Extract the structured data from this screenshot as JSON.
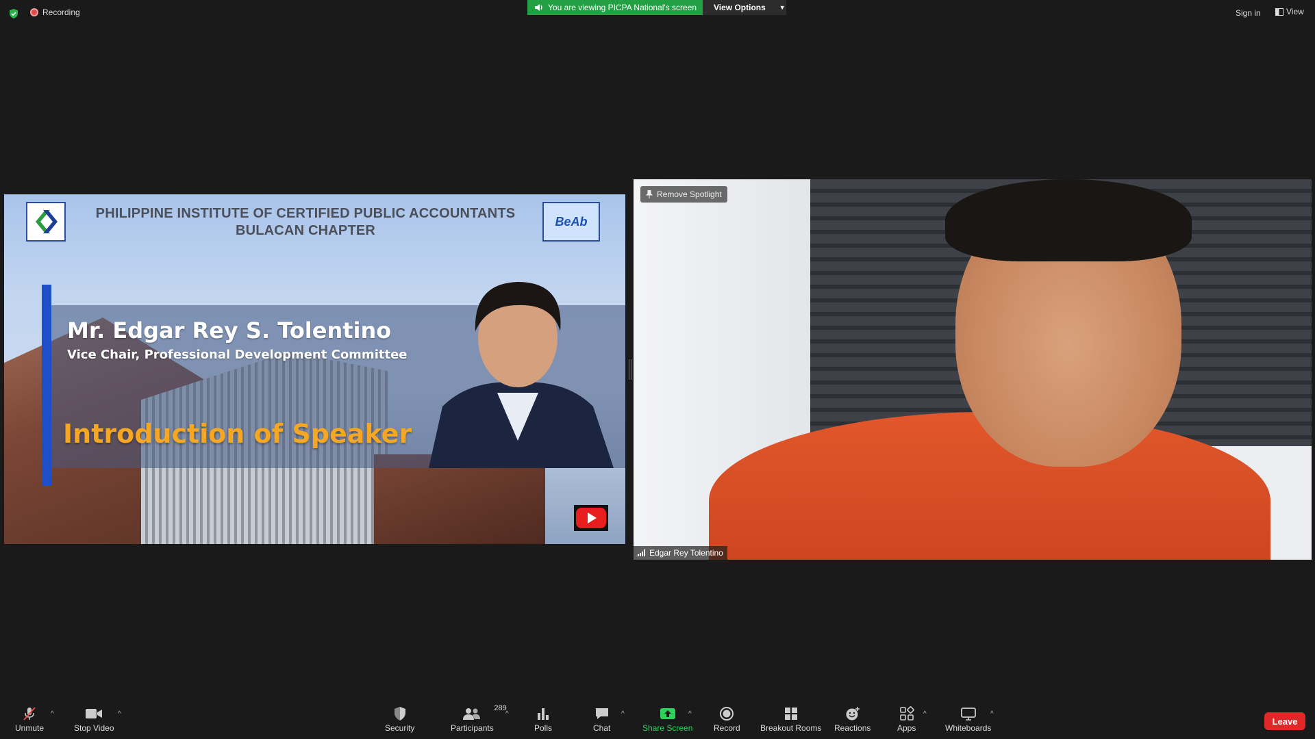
{
  "topbar": {
    "recording_label": "Recording",
    "viewing_banner": "You are viewing PICPA National's screen",
    "view_options_label": "View Options",
    "sign_in_label": "Sign in",
    "view_label": "View"
  },
  "slide": {
    "org_line1": "PHILIPPINE INSTITUTE OF CERTIFIED PUBLIC ACCOUNTANTS",
    "org_line2": "BULACAN CHAPTER",
    "speaker_name": "Mr. Edgar Rey S. Tolentino",
    "speaker_role": "Vice Chair, Professional Development Committee",
    "intro_text": "Introduction of Speaker",
    "logo_right_text": "BeAb"
  },
  "video": {
    "remove_spotlight_label": "Remove Spotlight",
    "participant_name": "Edgar Rey Tolentino"
  },
  "toolbar": {
    "unmute": "Unmute",
    "stop_video": "Stop Video",
    "security": "Security",
    "participants": "Participants",
    "participants_count": "289",
    "polls": "Polls",
    "chat": "Chat",
    "share_screen": "Share Screen",
    "record": "Record",
    "breakout_rooms": "Breakout Rooms",
    "reactions": "Reactions",
    "apps": "Apps",
    "whiteboards": "Whiteboards",
    "leave": "Leave"
  },
  "colors": {
    "banner_green": "#23a043",
    "share_green": "#2bd35a",
    "leave_red": "#e02828",
    "slide_accent_blue": "#1e4fc8",
    "intro_orange": "#f5a623"
  }
}
